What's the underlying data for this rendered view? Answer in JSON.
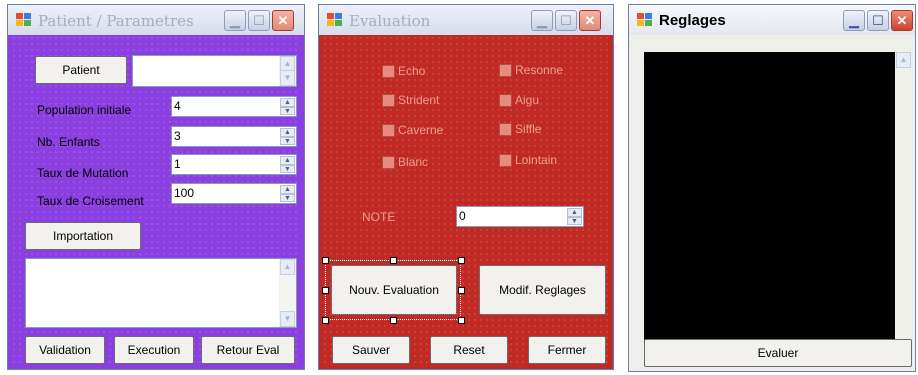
{
  "patient_window": {
    "title": "Patient / Parametres",
    "patient_button": "Patient",
    "patient_value": "",
    "fields": [
      {
        "label": "Population initiale",
        "value": "4"
      },
      {
        "label": "Nb. Enfants",
        "value": "3"
      },
      {
        "label": "Taux de Mutation",
        "value": "1"
      },
      {
        "label": "Taux de Croisement",
        "value": "100"
      }
    ],
    "import_button": "Importation",
    "buttons": {
      "validation": "Validation",
      "execution": "Execution",
      "retour": "Retour Eval"
    },
    "bg_color": "#8c3fe0"
  },
  "evaluation_window": {
    "title": "Evaluation",
    "checkboxes_left": [
      "Echo",
      "Strident",
      "Caverne",
      "Blanc"
    ],
    "checkboxes_right": [
      "Resonne",
      "Aigu",
      "Siffle",
      "Lointain"
    ],
    "note_label": "NOTE",
    "note_value": "0",
    "buttons": {
      "nouv": "Nouv. Evaluation",
      "modif": "Modif. Reglages",
      "sauver": "Sauver",
      "reset": "Reset",
      "fermer": "Fermer"
    },
    "bg_color": "#c12a24"
  },
  "reglages_window": {
    "title": "Reglages",
    "evaluer_button": "Evaluer",
    "display_color": "#000000"
  },
  "icons": {
    "minimize": "minimize-icon",
    "maximize": "maximize-icon",
    "close": "close-icon",
    "app": "app-icon"
  }
}
